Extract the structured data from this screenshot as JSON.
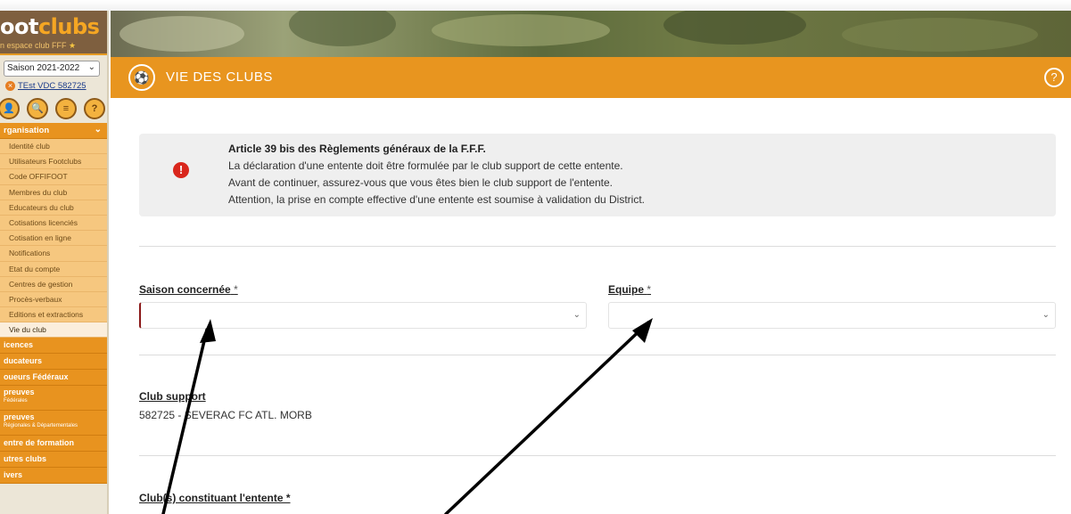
{
  "sidebar": {
    "logo_prefix": "oot",
    "logo_suffix": "clubs",
    "logo_tagline": "n espace club FFF",
    "season": "Saison 2021-2022",
    "club_name": "TEst VDC 582725",
    "menu_header": "rganisation",
    "menu_items": [
      "Identité club",
      "Utilisateurs Footclubs",
      "Code OFFIFOOT",
      "Membres du club",
      "Educateurs du club",
      "Cotisations licenciés",
      "Cotisation en ligne",
      "Notifications",
      "Etat du compte",
      "Centres de gestion",
      "Procès-verbaux",
      "Editions et extractions",
      "Vie du club"
    ],
    "groups": [
      {
        "label": "icences",
        "sub": ""
      },
      {
        "label": "ducateurs",
        "sub": ""
      },
      {
        "label": "oueurs Fédéraux",
        "sub": ""
      },
      {
        "label": "preuves",
        "sub": "Fédérales"
      },
      {
        "label": "preuves",
        "sub": "Régionales & Départementales"
      },
      {
        "label": "entre de formation",
        "sub": ""
      },
      {
        "label": "utres clubs",
        "sub": ""
      },
      {
        "label": "ivers",
        "sub": ""
      }
    ]
  },
  "header": {
    "title": "VIE DES CLUBS",
    "help_label": "?"
  },
  "alert": {
    "title": "Article 39 bis des Règlements généraux de la F.F.F.",
    "line1": "La déclaration d'une entente doit être formulée par le club support de cette entente.",
    "line2": "Avant de continuer, assurez-vous que vous êtes bien le club support de l'entente.",
    "line3": "Attention, la prise en compte effective d'une entente est soumise à validation du District."
  },
  "form": {
    "season_label": "Saison concernée",
    "team_label": "Equipe",
    "required_mark": "*",
    "club_support_label": "Club support",
    "club_support_value": "582725 - SEVERAC FC ATL. MORB",
    "clubs_label": "Club(s) constituant l'entente *"
  },
  "colors": {
    "orange": "#e8951f",
    "menu_item": "#f6c77f",
    "alert_icon": "#d9261c"
  }
}
